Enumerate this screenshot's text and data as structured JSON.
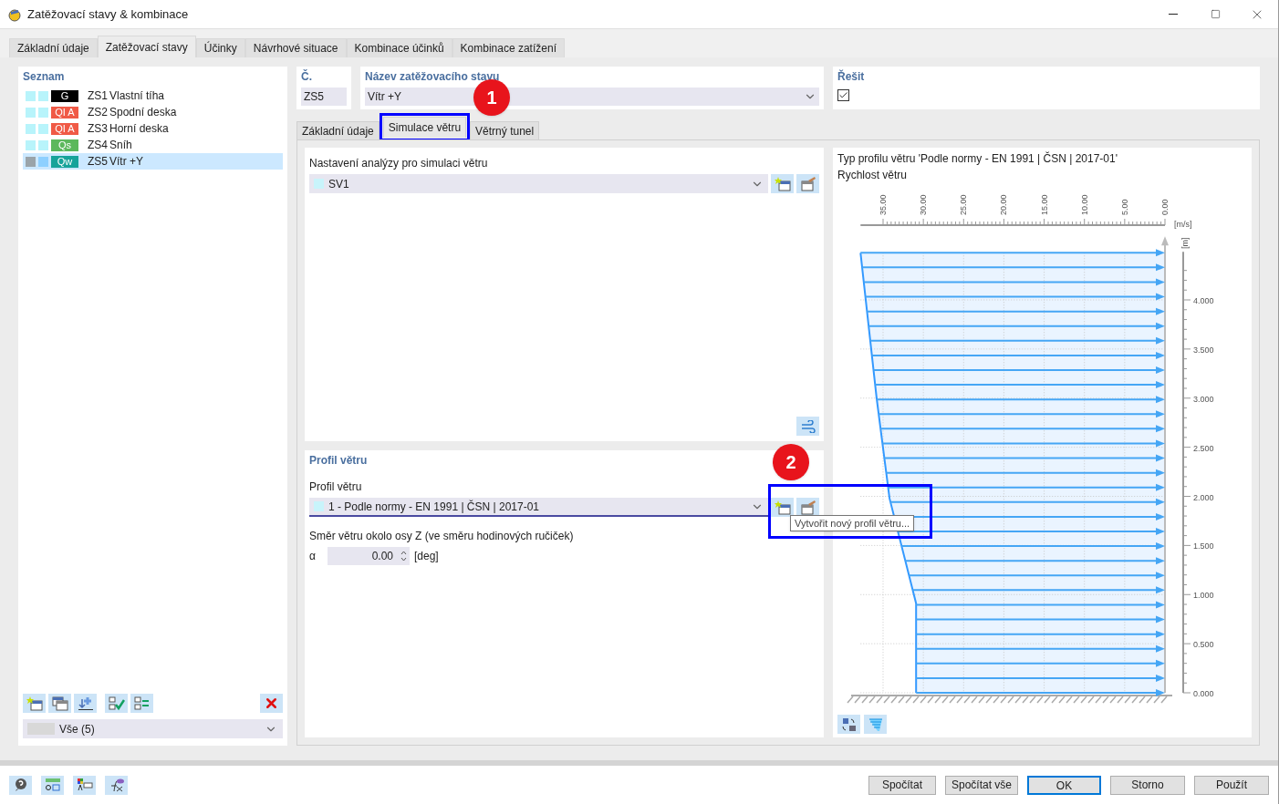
{
  "window": {
    "title": "Zatěžovací stavy & kombinace"
  },
  "tabs": [
    {
      "label": "Základní údaje",
      "selected": false
    },
    {
      "label": "Zatěžovací stavy",
      "selected": true
    },
    {
      "label": "Účinky",
      "selected": false
    },
    {
      "label": "Návrhové situace",
      "selected": false
    },
    {
      "label": "Kombinace účinků",
      "selected": false
    },
    {
      "label": "Kombinace zatížení",
      "selected": false
    }
  ],
  "list": {
    "title": "Seznam",
    "items": [
      {
        "badge": "G",
        "color": "#000000",
        "id": "ZS1",
        "name": "Vlastní tíha",
        "selected": false
      },
      {
        "badge": "QI A",
        "color": "#f05a46",
        "id": "ZS2",
        "name": "Spodní deska",
        "selected": false
      },
      {
        "badge": "QI A",
        "color": "#f05a46",
        "id": "ZS3",
        "name": "Horní deska",
        "selected": false
      },
      {
        "badge": "Qs",
        "color": "#5cb85c",
        "id": "ZS4",
        "name": "Sníh",
        "selected": false
      },
      {
        "badge": "Qw",
        "color": "#16a39a",
        "id": "ZS5",
        "name": "Vítr +Y",
        "selected": true
      }
    ]
  },
  "filter": {
    "value": "Vše (5)"
  },
  "number": {
    "label": "Č.",
    "value": "ZS5"
  },
  "name": {
    "label": "Název zatěžovacího stavu",
    "value": "Vítr +Y"
  },
  "solve": {
    "label": "Řešit",
    "checked": true
  },
  "subtabs": [
    {
      "label": "Základní údaje",
      "selected": false
    },
    {
      "label": "Simulace větru",
      "selected": true
    },
    {
      "label": "Větrný tunel",
      "selected": false
    }
  ],
  "analysis": {
    "label": "Nastavení analýzy pro simulaci větru",
    "value": "SV1"
  },
  "profile": {
    "title": "Profil větru",
    "label": "Profil větru",
    "value": "1 - Podle normy - EN 1991 | ČSN | 2017-01",
    "tooltip": "Vytvořit nový profil větru..."
  },
  "direction": {
    "label": "Směr větru okolo osy Z (ve směru hodinových ručiček)",
    "symbol": "α",
    "value": "0.00",
    "unit": "[deg]"
  },
  "chart": {
    "chart_data": {
      "type": "line",
      "orientation": "horizontal",
      "title": "Typ profilu větru 'Podle normy - EN 1991 | ČSN | 2017-01'",
      "xlabel": "[m/s]",
      "ylabel": "[m]",
      "x": [
        0,
        0.91,
        1.98,
        3.0,
        4.48
      ],
      "series": [
        {
          "name": "Rychlost větru",
          "color": "#3399ff",
          "values": [
            30.9,
            30.9,
            34.2,
            35.8,
            37.8
          ]
        }
      ],
      "grid": true,
      "xlim": [
        38,
        0
      ],
      "ylim": [
        0,
        4.48
      ],
      "xticks": [
        {
          "value": 35,
          "label": "35.00"
        },
        {
          "value": 30,
          "label": "30.00"
        },
        {
          "value": 25,
          "label": "25.00"
        },
        {
          "value": 20,
          "label": "20.00"
        },
        {
          "value": 15,
          "label": "15.00"
        },
        {
          "value": 10,
          "label": "10.00"
        },
        {
          "value": 5,
          "label": "5.00"
        },
        {
          "value": 0,
          "label": "0.00"
        }
      ],
      "yticks": [
        {
          "value": 4,
          "label": "4.000"
        },
        {
          "value": 3.5,
          "label": "3.500"
        },
        {
          "value": 3,
          "label": "3.000"
        },
        {
          "value": 2.5,
          "label": "2.500"
        },
        {
          "value": 2,
          "label": "2.000"
        },
        {
          "value": 1.5,
          "label": "1.500"
        },
        {
          "value": 1,
          "label": "1.000"
        },
        {
          "value": 0.5,
          "label": "0.500"
        },
        {
          "value": 0,
          "label": "0.000"
        }
      ]
    }
  },
  "annotations": [
    "1",
    "2"
  ],
  "footer_buttons": [
    {
      "label": "Spočítat",
      "kind": "normal"
    },
    {
      "label": "Spočítat vše",
      "kind": "normal"
    },
    {
      "label": "OK",
      "kind": "default"
    },
    {
      "label": "Storno",
      "kind": "normal"
    },
    {
      "label": "Použít",
      "kind": "normal"
    }
  ]
}
